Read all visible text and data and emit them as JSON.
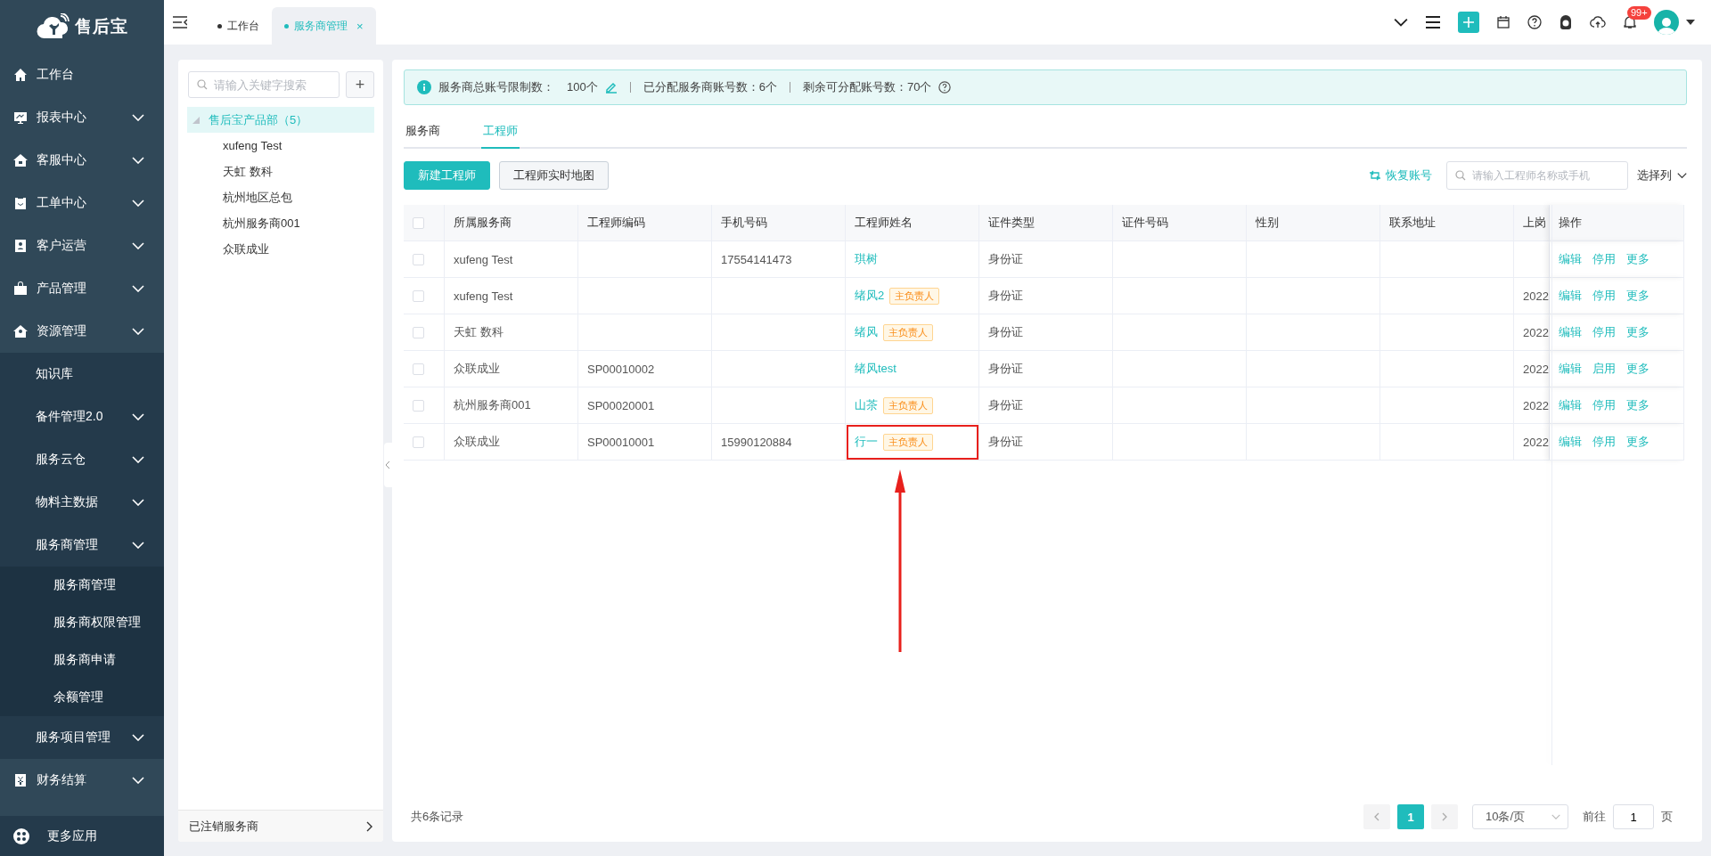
{
  "sidebar": {
    "logo_text": "售后宝",
    "items": [
      {
        "label": "工作台",
        "kind": "home",
        "expandable": false
      },
      {
        "label": "报表中心",
        "kind": "report",
        "expandable": true
      },
      {
        "label": "客服中心",
        "kind": "service",
        "expandable": true
      },
      {
        "label": "工单中心",
        "kind": "order",
        "expandable": true
      },
      {
        "label": "客户运营",
        "kind": "customer",
        "expandable": true
      },
      {
        "label": "产品管理",
        "kind": "product",
        "expandable": true
      },
      {
        "label": "资源管理",
        "kind": "resource",
        "expandable": true,
        "expanded": true,
        "children": [
          {
            "label": "知识库",
            "expandable": false
          },
          {
            "label": "备件管理2.0",
            "expandable": true
          },
          {
            "label": "服务云仓",
            "expandable": true
          },
          {
            "label": "物料主数据",
            "expandable": true
          },
          {
            "label": "服务商管理",
            "expandable": true,
            "expanded": true,
            "children": [
              {
                "label": "服务商管理",
                "expandable": false
              },
              {
                "label": "服务商权限管理",
                "expandable": false
              },
              {
                "label": "服务商申请",
                "expandable": false
              },
              {
                "label": "余额管理",
                "expandable": false
              }
            ]
          },
          {
            "label": "服务项目管理",
            "expandable": true
          }
        ]
      },
      {
        "label": "财务结算",
        "kind": "finance",
        "expandable": true
      }
    ],
    "footer": {
      "label": "更多应用"
    }
  },
  "topbar": {
    "tabs": [
      {
        "label": "工作台",
        "selected": false
      },
      {
        "label": "服务商管理",
        "selected": true,
        "close": "×"
      }
    ],
    "notification_badge": "99+"
  },
  "tree": {
    "search": {
      "placeholder": "请输入关键字搜索"
    },
    "add_button": "+",
    "root": {
      "label": "售后宝产品部（5）",
      "selected": true,
      "expanded": true,
      "children": [
        {
          "label": "xufeng Test",
          "selected": false
        },
        {
          "label": "天虹 数科",
          "selected": false
        },
        {
          "label": "杭州地区总包",
          "selected": false
        },
        {
          "label": "杭州服务商001",
          "selected": false
        },
        {
          "label": "众联成业",
          "selected": false
        }
      ]
    },
    "footer": {
      "label": "已注销服务商"
    }
  },
  "info_bar": {
    "items": [
      {
        "label": "服务商总账号限制数：",
        "value": "100个",
        "editable": true
      },
      {
        "label": "已分配服务商账号数：6个",
        "editable": false
      },
      {
        "label": "剩余可分配账号数：70个",
        "editable": false
      }
    ]
  },
  "tabs": [
    {
      "label": "服务商",
      "selected": false
    },
    {
      "label": "工程师",
      "selected": true
    }
  ],
  "toolbar": {
    "buttons": [
      {
        "label": "新建工程师",
        "kind": "primary"
      },
      {
        "label": "工程师实时地图",
        "kind": "default"
      }
    ],
    "restore_link": "恢复账号",
    "search": {
      "placeholder": "请输入工程师名称或手机"
    },
    "column_picker": "选择列"
  },
  "table": {
    "header_checked": false,
    "columns": [
      "所属服务商",
      "工程师编码",
      "手机号码",
      "工程师姓名",
      "证件类型",
      "证件号码",
      "性别",
      "联系地址",
      "上岗",
      "操作"
    ],
    "rows": [
      {
        "checked": false,
        "highlighted": false,
        "provider": "xufeng Test",
        "phone": "17554141473",
        "name": "琪树",
        "id_type": "身份证",
        "actions": [
          "编辑",
          "停用",
          "更多"
        ]
      },
      {
        "checked": false,
        "highlighted": false,
        "provider": "xufeng Test",
        "name": "绪风2",
        "tag": "主负责人",
        "id_type": "身份证",
        "start": "2022",
        "actions": [
          "编辑",
          "停用",
          "更多"
        ]
      },
      {
        "checked": false,
        "highlighted": false,
        "provider": "天虹 数科",
        "name": "绪风",
        "tag": "主负责人",
        "id_type": "身份证",
        "start": "2022",
        "actions": [
          "编辑",
          "停用",
          "更多"
        ]
      },
      {
        "checked": false,
        "highlighted": false,
        "provider": "众联成业",
        "code": "SP00010002",
        "name": "绪风test",
        "id_type": "身份证",
        "start": "2022",
        "actions": [
          "编辑",
          "启用",
          "更多"
        ]
      },
      {
        "checked": false,
        "highlighted": false,
        "provider": "杭州服务商001",
        "code": "SP00020001",
        "name": "山茶",
        "tag": "主负责人",
        "id_type": "身份证",
        "start": "2022",
        "actions": [
          "编辑",
          "停用",
          "更多"
        ]
      },
      {
        "checked": false,
        "highlighted": true,
        "provider": "众联成业",
        "code": "SP00010001",
        "phone": "15990120884",
        "name": "行一",
        "tag": "主负责人",
        "id_type": "身份证",
        "start": "2022",
        "actions": [
          "编辑",
          "停用",
          "更多"
        ]
      }
    ]
  },
  "pagination": {
    "total": "共6条记录",
    "pages": [
      {
        "label": "1",
        "selected": true
      }
    ],
    "page_size": "10条/页",
    "goto_label": "前往",
    "goto_value": "1",
    "page_suffix": "页"
  }
}
